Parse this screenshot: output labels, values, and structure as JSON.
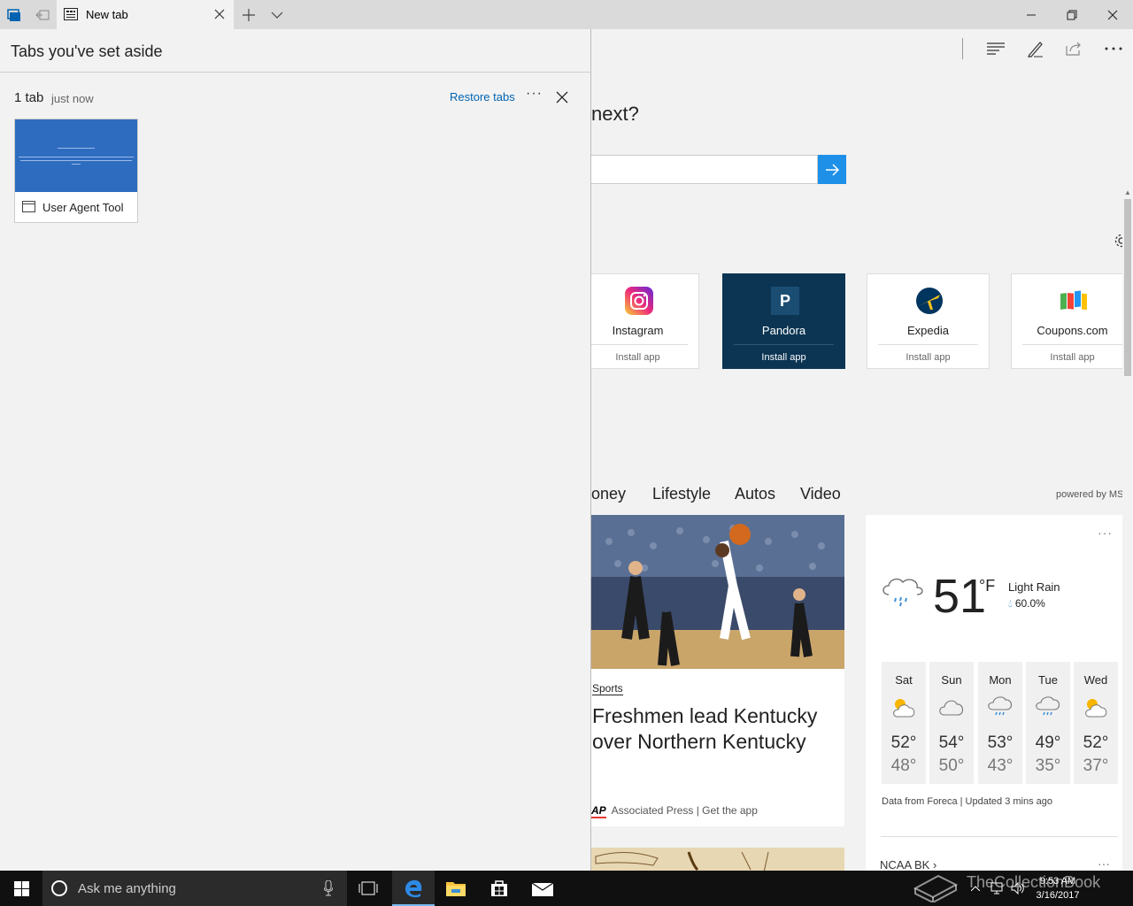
{
  "tabbar": {
    "tab_title": "New tab"
  },
  "aside": {
    "title": "Tabs you've set aside",
    "group_count": "1 tab",
    "group_time": "just now",
    "restore_label": "Restore tabs",
    "more_label": "···",
    "tabs": [
      {
        "label": "User Agent Tool"
      }
    ]
  },
  "ntp": {
    "heading": "next?",
    "tiles": [
      {
        "name": "Instagram",
        "action": "Install app"
      },
      {
        "name": "Pandora",
        "action": "Install app",
        "logo_letter": "P"
      },
      {
        "name": "Expedia",
        "action": "Install app"
      },
      {
        "name": "Coupons.com",
        "action": "Install app"
      }
    ],
    "categories": [
      "oney",
      "Lifestyle",
      "Autos",
      "Video"
    ],
    "powered_by": "powered by MS",
    "news": {
      "category": "Sports",
      "headline": "Freshmen lead Kentucky over Northern Kentucky",
      "source_logo": "AP",
      "source": "Associated Press",
      "get_app": "| Get the app"
    },
    "weather": {
      "more": "···",
      "temp": "51",
      "unit": "°F",
      "condition": "Light Rain",
      "rain_chance": "60.0%",
      "forecast": [
        {
          "day": "Sat",
          "hi": "52°",
          "lo": "48°",
          "icon": "partly-sunny"
        },
        {
          "day": "Sun",
          "hi": "54°",
          "lo": "50°",
          "icon": "cloudy"
        },
        {
          "day": "Mon",
          "hi": "53°",
          "lo": "43°",
          "icon": "rain"
        },
        {
          "day": "Tue",
          "hi": "49°",
          "lo": "35°",
          "icon": "rain"
        },
        {
          "day": "Wed",
          "hi": "52°",
          "lo": "37°",
          "icon": "partly-sunny"
        }
      ],
      "footer": "Data from Foreca | Updated 3 mins ago"
    },
    "ncaa": "NCAA BK",
    "ncaa_more": "···"
  },
  "taskbar": {
    "search_placeholder": "Ask me anything",
    "time": "9:53 AM",
    "date": "3/16/2017",
    "watermark": "TheCollectionBook"
  },
  "colors": {
    "accent": "#0063b1",
    "search_button": "#1e90e8",
    "pandora": "#0c3553"
  }
}
